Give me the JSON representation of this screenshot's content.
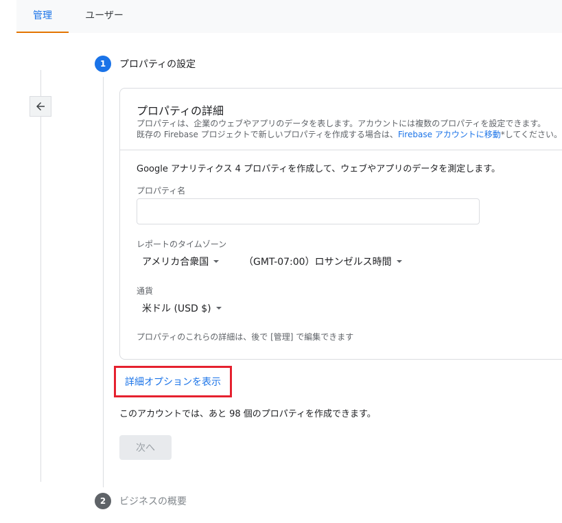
{
  "tabs": [
    {
      "label": "管理",
      "active": true
    },
    {
      "label": "ユーザー",
      "active": false
    }
  ],
  "colors": {
    "accent": "#1a73e8",
    "tab_underline": "#e37400",
    "highlight_box": "#e5202e"
  },
  "icons": {
    "back": "arrow-left-icon"
  },
  "steps": [
    {
      "number": "1",
      "title": "プロパティの設定",
      "state": "active"
    },
    {
      "number": "2",
      "title": "ビジネスの概要",
      "state": "inactive"
    }
  ],
  "card": {
    "title": "プロパティの詳細",
    "desc_line1": "プロパティは、企業のウェブやアプリのデータを表します。アカウントには複数のプロパティを設定できます。",
    "desc_line2_prefix": "既存の Firebase プロジェクトで新しいプロパティを作成する場合は、",
    "desc_line2_link": "Firebase アカウントに移動",
    "desc_line2_suffix": "*してください。",
    "intro": "Google アナリティクス 4 プロパティを作成して、ウェブやアプリのデータを測定します。",
    "property_name_label": "プロパティ名",
    "property_name_value": "",
    "timezone_label": "レポートのタイムゾーン",
    "country_value": "アメリカ合衆国",
    "timezone_value": "（GMT-07:00）ロサンゼルス時間",
    "currency_label": "通貨",
    "currency_value": "米ドル (USD $)",
    "footnote": "プロパティのこれらの詳細は、後で [管理] で編集できます"
  },
  "advanced_options_link": "詳細オプションを表示",
  "quota_text": "このアカウントでは、あと 98 個のプロパティを作成できます。",
  "next_button": "次へ"
}
